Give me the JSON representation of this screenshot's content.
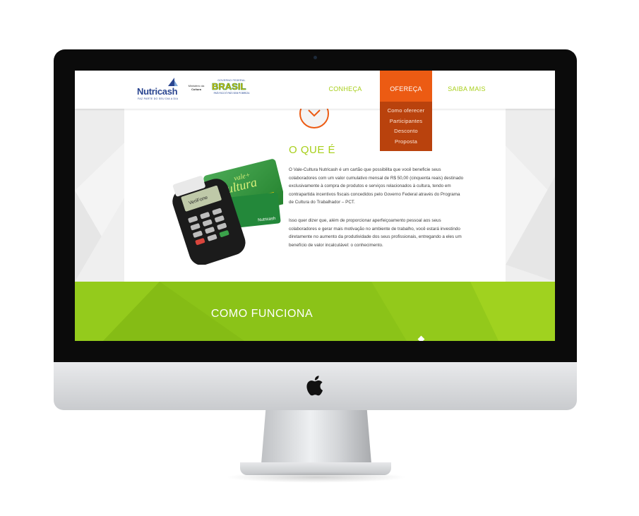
{
  "header": {
    "logo": {
      "name": "Nutricash",
      "tagline": "FAZ PARTE DO SEU DIA A DIA"
    },
    "ministerio": {
      "line1": "Ministério da",
      "line2": "Cultura"
    },
    "governo": {
      "top": "GOVERNO FEDERAL",
      "word": "BRASIL",
      "bottom": "PAÍS RICO É PAÍS SEM POBREZA"
    },
    "nav": [
      {
        "label": "CONHEÇA",
        "active": false
      },
      {
        "label": "OFEREÇA",
        "active": true
      },
      {
        "label": "SAIBA MAIS",
        "active": false
      }
    ],
    "dropdown": [
      "Como oferecer",
      "Participantes",
      "Desconto",
      "Proposta"
    ]
  },
  "section": {
    "title": "O QUE É",
    "paragraph1": "O Vale-Cultura Nutricash é um cartão que possibilita que você beneficie seus colaboradores com um valor cumulativo mensal de R$ 50,00 (cinquenta reais) destinado exclusivamente à compra de produtos e serviços relacionados à cultura, tendo em contrapartida incentivos fiscais concedidos pelo Governo Federal através do Programa de Cultura do Trabalhador – PCT.",
    "paragraph2": "Isso quer dizer que, além de proporcionar aperfeiçoamento pessoal aos seus colaboradores e gerar mais motivação no ambiente de trabalho, você estará investindo diretamente no aumento da produtividade dos seus profissionais, entregando a eles um benefício de valor incalculável: o conhecimento."
  },
  "card": {
    "line1": "vale+",
    "line2": "cultura",
    "brand": "Nutricash",
    "terminal_label": "VeriFone"
  },
  "band": {
    "title": "COMO FUNCIONA"
  },
  "colors": {
    "accent_green": "#a8cf1a",
    "band_green": "#8bc318",
    "accent_orange": "#ec5b13",
    "dropdown_bg": "#b9420d",
    "brand_blue": "#2a4590"
  }
}
